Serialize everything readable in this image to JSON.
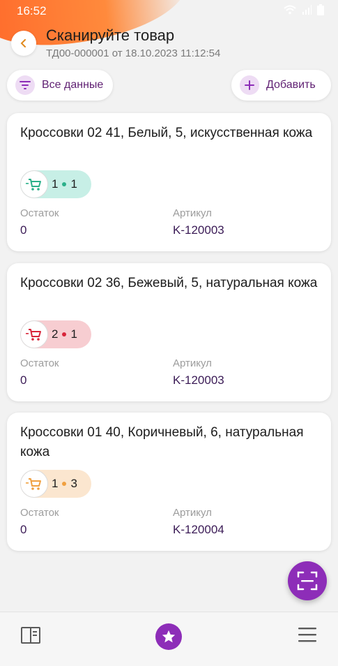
{
  "status_bar": {
    "time": "16:52"
  },
  "header": {
    "title": "Сканируйте товар",
    "subtitle": "ТД00-000001 от 18.10.2023 11:12:54"
  },
  "filters": {
    "all_label": "Все данные",
    "add_label": "Добавить"
  },
  "labels": {
    "stock": "Остаток",
    "article": "Артикул"
  },
  "items": [
    {
      "name": "Кроссовки 02 41, Белый, 5, искусственная кожа",
      "count_a": "1",
      "count_b": "1",
      "stock": "0",
      "article": "K-120003",
      "color": "#2bb08a",
      "chip_bg": "#c7efe6"
    },
    {
      "name": "Кроссовки 02 36, Бежевый, 5, натуральная кожа",
      "count_a": "2",
      "count_b": "1",
      "stock": "0",
      "article": "K-120003",
      "color": "#d8253a",
      "chip_bg": "#f7cdd1"
    },
    {
      "name": "Кроссовки 01 40, Коричневый, 6, натуральная кожа",
      "count_a": "1",
      "count_b": "3",
      "stock": "0",
      "article": "K-120004",
      "color": "#f0a040",
      "chip_bg": "#fbe6cf"
    }
  ],
  "colors": {
    "accent": "#8d2db8",
    "accent_dark": "#5f1f72"
  }
}
